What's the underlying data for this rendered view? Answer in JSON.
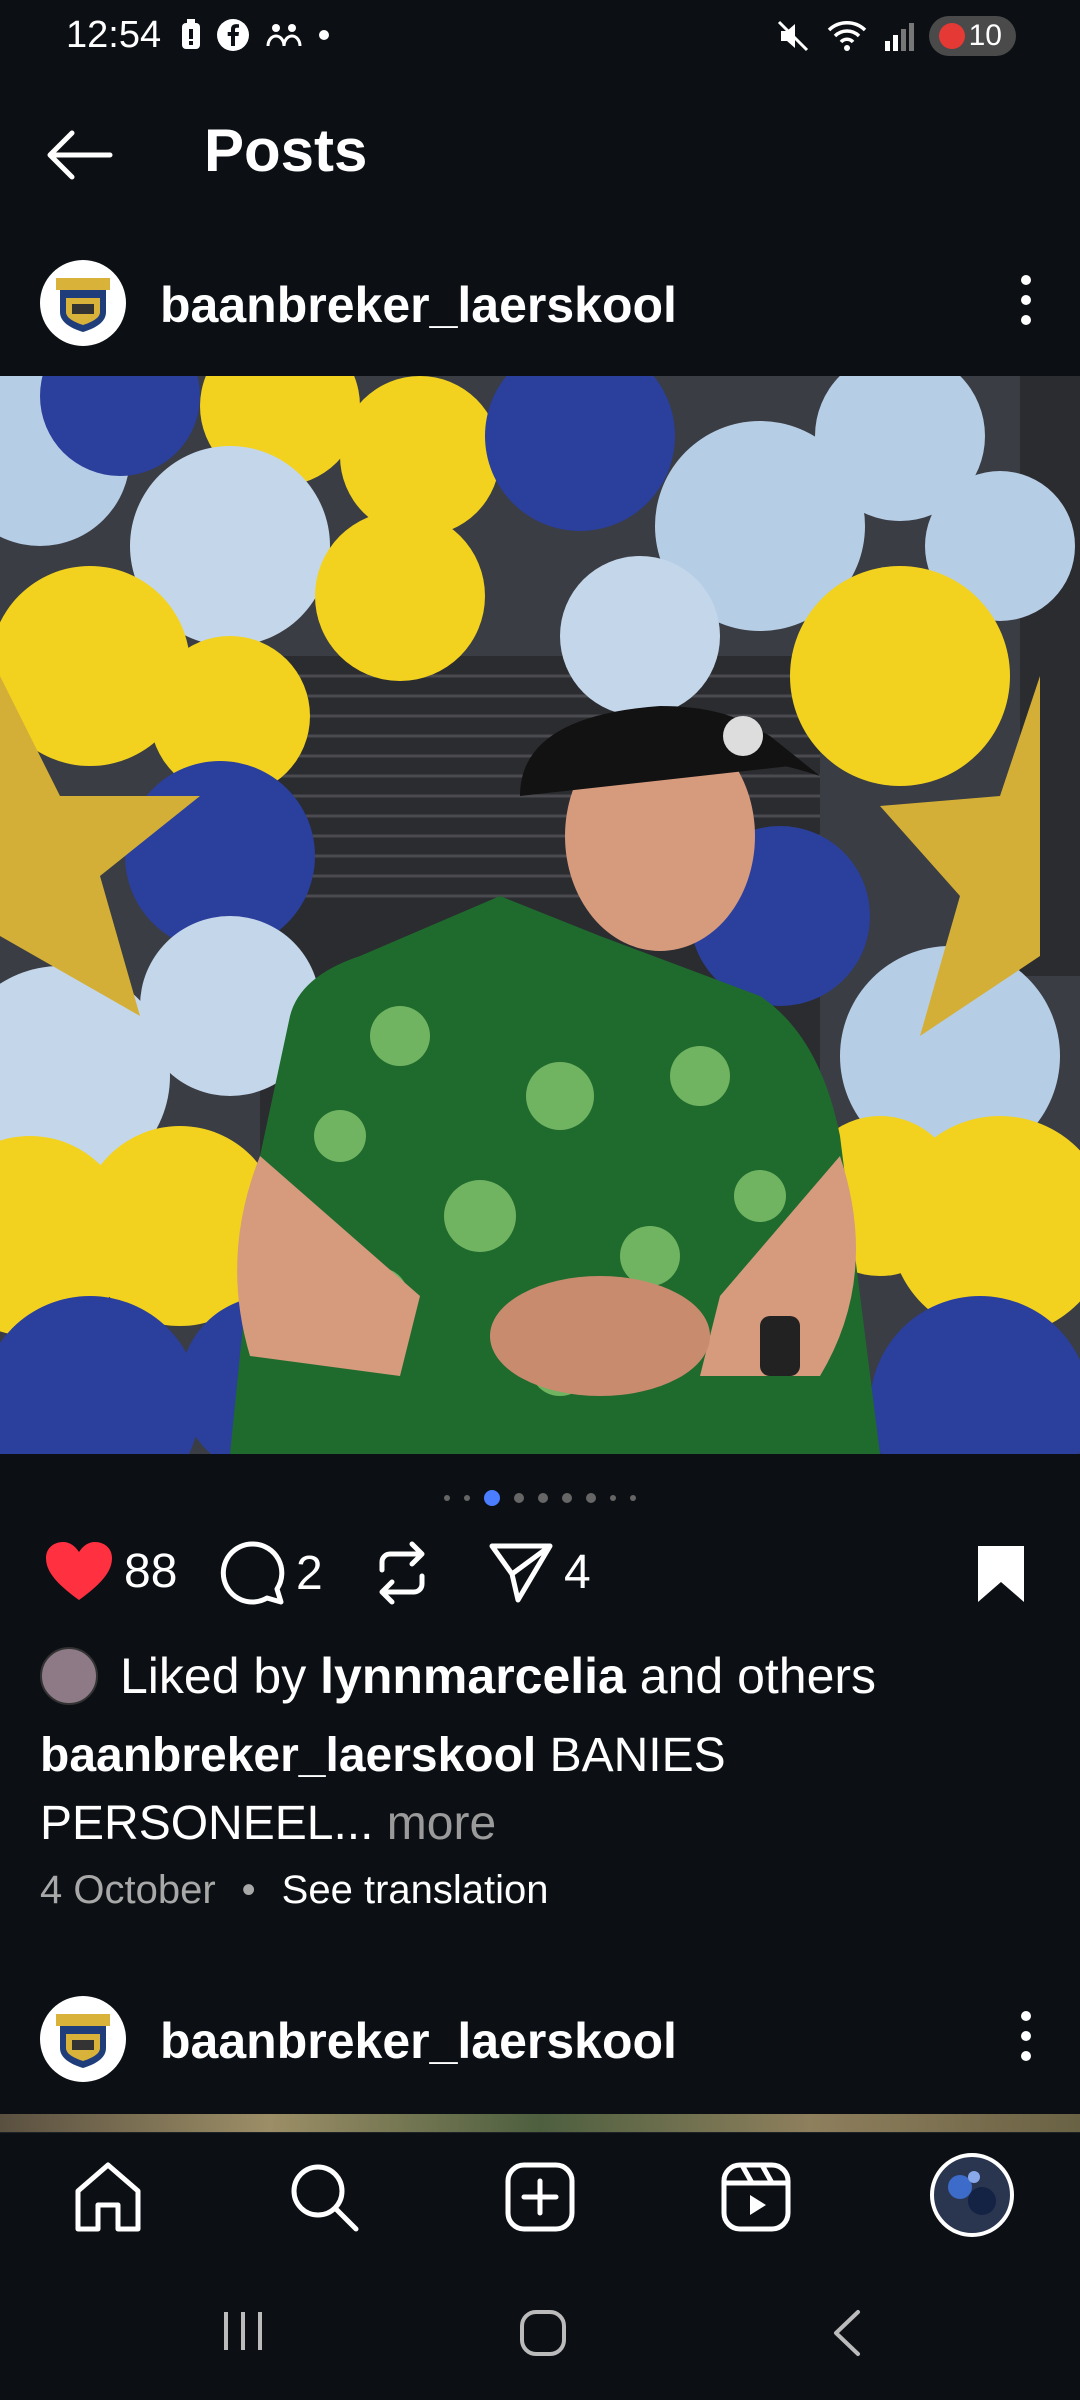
{
  "status_bar": {
    "time": "12:54",
    "battery_level": "10"
  },
  "header": {
    "title": "Posts"
  },
  "post": {
    "username": "baanbreker_laerskool",
    "carousel_total": 8,
    "carousel_active_index": 1,
    "actions": {
      "likes": "88",
      "comments": "2",
      "shares": "4"
    },
    "liked_by_prefix": "Liked by",
    "liked_by_user": "lynnmarcelia",
    "liked_by_suffix": "and others",
    "caption_username": "baanbreker_laerskool",
    "caption_text": "BANIES PERSONEEL",
    "caption_ellipsis": "...",
    "caption_more": "more",
    "date": "4 October",
    "see_translation": "See translation"
  },
  "next_post": {
    "username": "baanbreker_laerskool"
  },
  "colors": {
    "background": "#0c1014",
    "like_red": "#ff3040",
    "accent_blue": "#4a7dff"
  },
  "icons": [
    "back-arrow-icon",
    "more-vertical-icon",
    "heart-icon",
    "comment-icon",
    "repost-icon",
    "send-icon",
    "bookmark-icon",
    "home-icon",
    "search-icon",
    "create-icon",
    "reels-icon",
    "profile-avatar"
  ]
}
